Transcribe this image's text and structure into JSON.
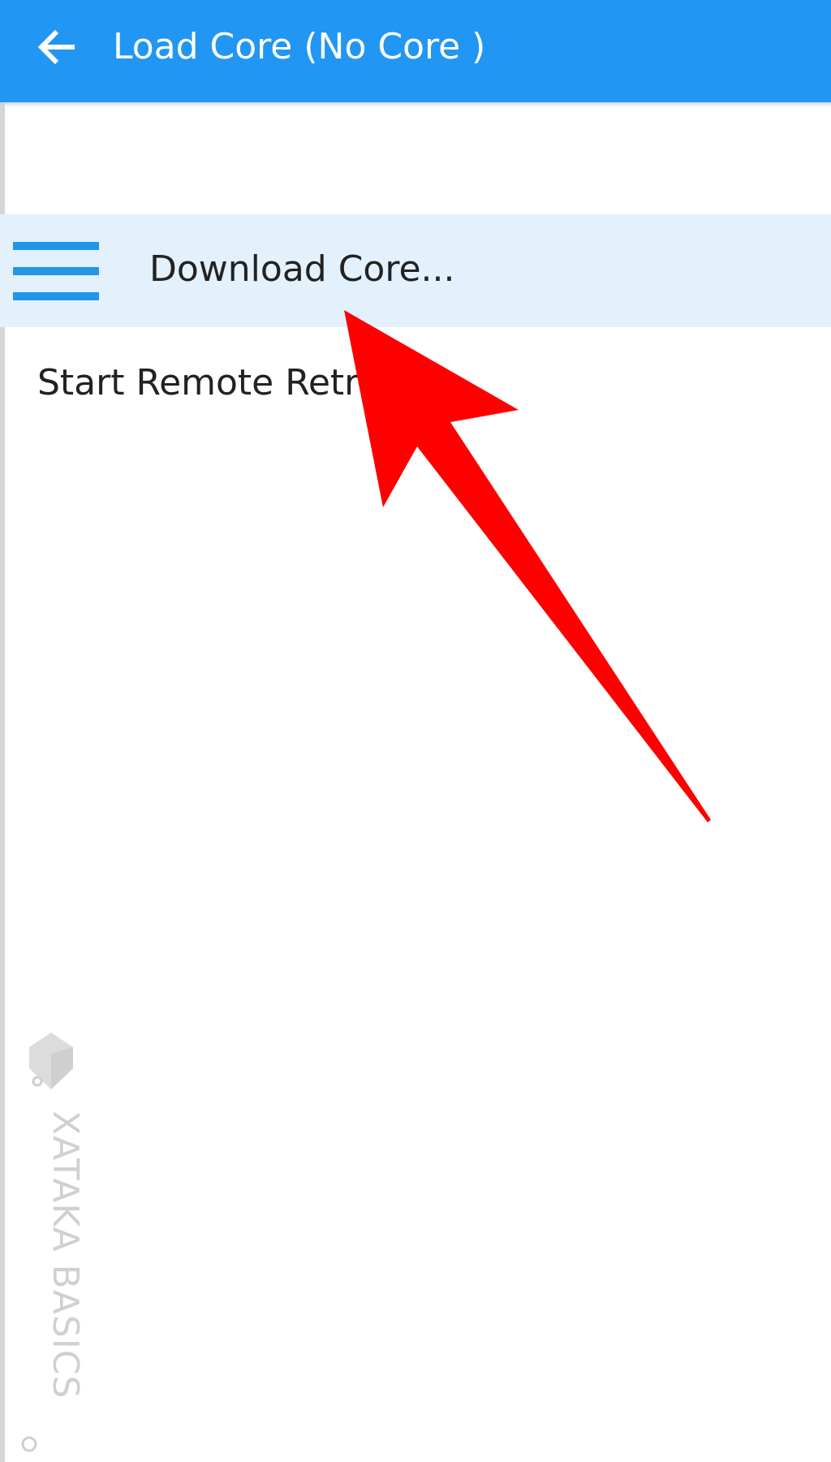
{
  "app_bar": {
    "title": "Load Core (No Core )",
    "back_icon": "arrow-left-icon",
    "background": "#2196f3"
  },
  "menu": {
    "items": [
      {
        "label": "Download Core...",
        "icon": "hamburger-menu-icon",
        "highlighted": true
      },
      {
        "label": "Start Remote Retr",
        "highlighted": false
      }
    ],
    "highlight_color": "#e3f1fd",
    "icon_color": "#2196e8"
  },
  "annotation": {
    "type": "arrow",
    "color": "#ff0000",
    "points_to": "Download Core..."
  },
  "watermark": {
    "text": "XATAKA BASICS",
    "icon": "graduation-cap-icon"
  }
}
